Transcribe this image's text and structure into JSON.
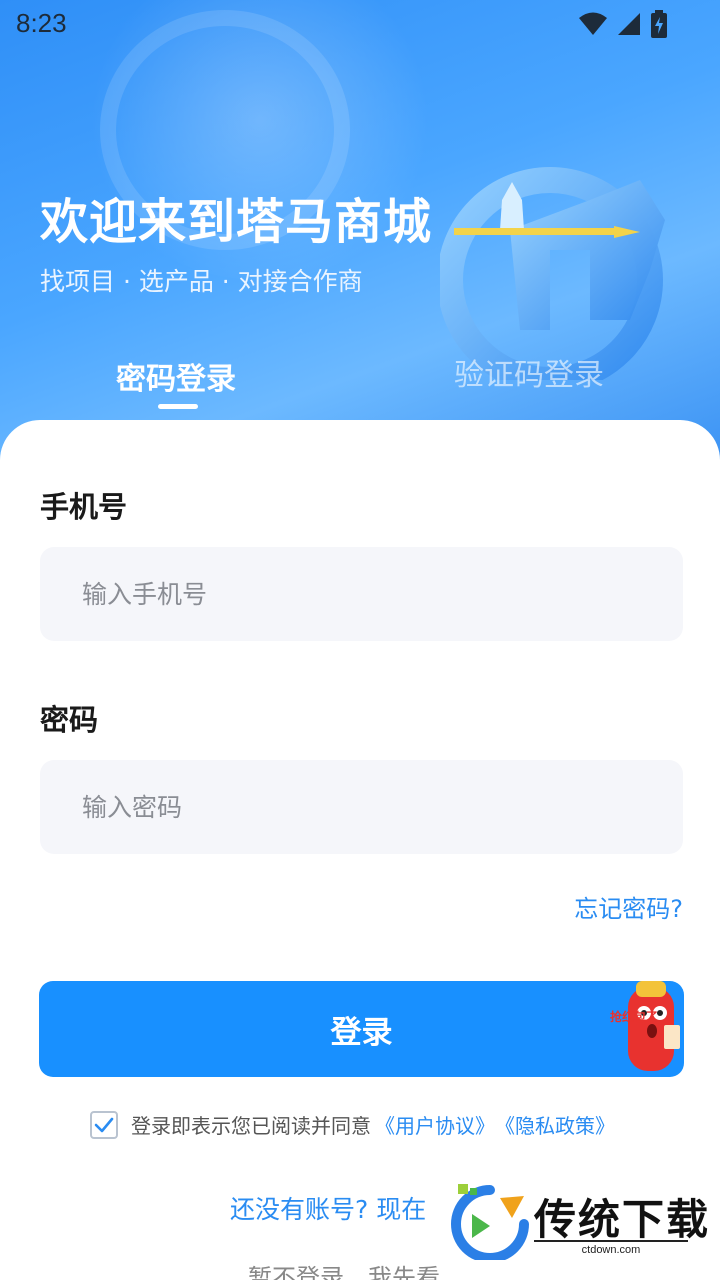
{
  "status_bar": {
    "time": "8:23"
  },
  "hero": {
    "title": "欢迎来到塔马商城",
    "subtitle": "找项目 · 选产品 · 对接合作商"
  },
  "tabs": [
    {
      "label": "密码登录",
      "active": true
    },
    {
      "label": "验证码登录",
      "active": false
    }
  ],
  "form": {
    "phone_label": "手机号",
    "phone_placeholder": "输入手机号",
    "password_label": "密码",
    "password_placeholder": "输入密码",
    "forgot_password": "忘记密码?",
    "login_button": "登录"
  },
  "agreement": {
    "checked": true,
    "prefix": "登录即表示您已阅读并同意",
    "user_agreement": "《用户协议》",
    "privacy_policy": "《隐私政策》"
  },
  "register_prompt": "还没有账号? 现在",
  "skip_login": "暂不登录，我先看",
  "mascot": {
    "text": "抢红包了"
  },
  "watermark": {
    "brand": "传统下载",
    "domain": "ctdown.com"
  },
  "colors": {
    "primary": "#1890ff",
    "link": "#2a8cf2",
    "input_bg": "#f5f6fa"
  }
}
